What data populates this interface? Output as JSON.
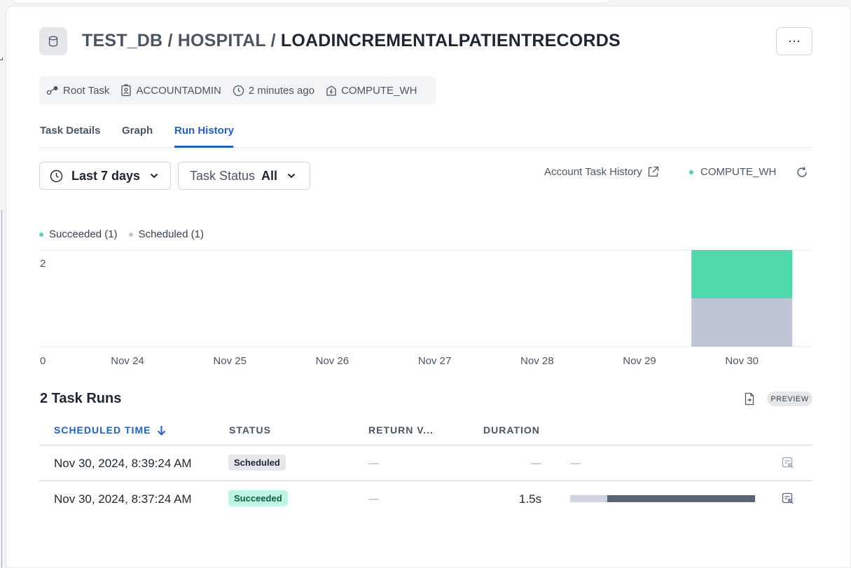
{
  "breadcrumb": {
    "db": "TEST_DB",
    "sep1": " / ",
    "schema": "HOSPITAL",
    "sep2": " / ",
    "task": "LOADINCREMENTALPATIENTRECORDS"
  },
  "more_button": "⋯",
  "meta": {
    "type": "Root Task",
    "owner": "ACCOUNTADMIN",
    "updated": "2 minutes ago",
    "warehouse": "COMPUTE_WH"
  },
  "tabs": [
    {
      "label": "Task Details"
    },
    {
      "label": "Graph"
    },
    {
      "label": "Run History"
    }
  ],
  "active_tab": "Run History",
  "filters": {
    "range": "Last 7 days",
    "status_label": "Task Status",
    "status_value": "All"
  },
  "account_task_history": "Account Task History",
  "warehouse_status": "COMPUTE_WH",
  "colors": {
    "succeeded": "#4fd8ab",
    "scheduled": "#bfc5d6",
    "accent": "#1d5fd0"
  },
  "chart_data": {
    "type": "bar",
    "stacked": true,
    "categories": [
      "Nov 24",
      "Nov 25",
      "Nov 26",
      "Nov 27",
      "Nov 28",
      "Nov 29",
      "Nov 30"
    ],
    "series": [
      {
        "name": "Scheduled",
        "values": [
          0,
          0,
          0,
          0,
          0,
          0,
          1
        ]
      },
      {
        "name": "Succeeded",
        "values": [
          0,
          0,
          0,
          0,
          0,
          0,
          1
        ]
      }
    ],
    "legend": [
      "Succeeded (1)",
      "Scheduled (1)"
    ],
    "ylim": [
      0,
      2
    ],
    "y_ticks": [
      "0",
      "2"
    ],
    "legend_position": "top-left"
  },
  "runs": {
    "title": "2 Task Runs",
    "preview": "PREVIEW",
    "columns": {
      "scheduled_time": "SCHEDULED TIME",
      "status": "STATUS",
      "return_value": "RETURN V...",
      "duration": "DURATION"
    },
    "rows": [
      {
        "time": "Nov 30, 2024, 8:39:24 AM",
        "status": "Scheduled",
        "return_value": "—",
        "duration": "—",
        "timeline": "—"
      },
      {
        "time": "Nov 30, 2024, 8:37:24 AM",
        "status": "Succeeded",
        "return_value": "—",
        "duration": "1.5s",
        "queued_fraction": 0.2,
        "running_fraction": 0.8
      }
    ]
  }
}
